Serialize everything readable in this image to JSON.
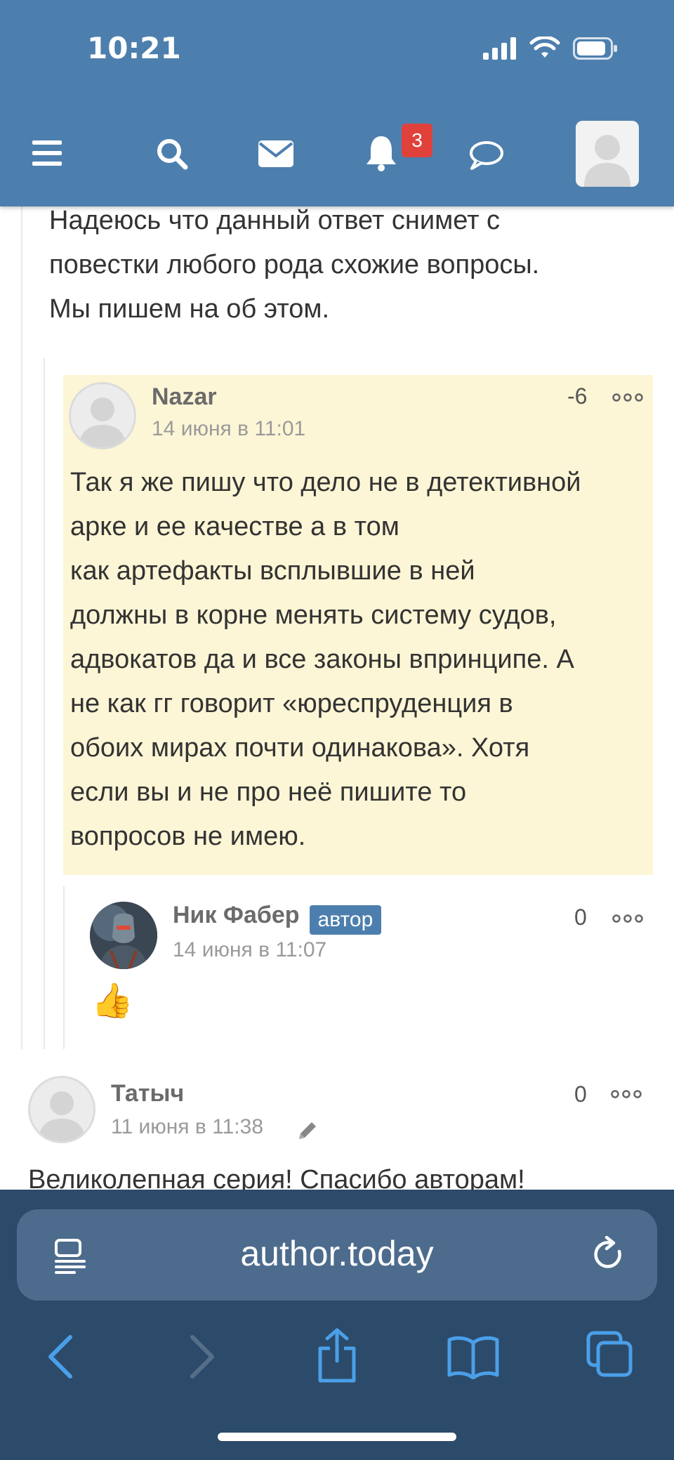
{
  "status": {
    "time": "10:21"
  },
  "header": {
    "notifications_count": "3",
    "icons": [
      "menu-icon",
      "search-icon",
      "mail-icon",
      "bell-icon",
      "chat-icon"
    ]
  },
  "comments": {
    "top_text_lines": [
      "Надеюсь что данный ответ снимет с",
      "повестки любого рода схожие вопросы.",
      "Мы пишем на об этом."
    ],
    "nazar": {
      "name": "Nazar",
      "date": "14 июня в 11:01",
      "rating": "-6",
      "lines": [
        "Так я же пишу что дело не в детективной",
        "арке и ее качестве а в том",
        "как артефакты всплывшие в ней",
        "должны в корне менять систему судов,",
        "адвокатов да и все законы впринципе. А",
        "не как гг говорит «юреспруденция в",
        "обоих мирах почти одинакова». Хотя",
        "если вы и не про неё пишите то",
        "вопросов не имею."
      ]
    },
    "nik": {
      "name": "Ник Фабер",
      "tag": "автор",
      "date": "14 июня в 11:07",
      "rating": "0",
      "body": "👍"
    },
    "tatych": {
      "name": "Татыч",
      "date": "11 июня в 11:38",
      "rating": "0",
      "body": "Великолепная серия! Спасибо авторам!"
    }
  },
  "browser": {
    "url": "author.today",
    "icons": [
      "reader-icon",
      "reload-icon",
      "back-icon",
      "forward-icon",
      "share-icon",
      "bookmarks-icon",
      "tabs-icon"
    ]
  },
  "colors": {
    "header": "#4d7fae",
    "highlight": "#fdf6d6",
    "browser": "#2c4a69",
    "badge": "#e0413b"
  }
}
